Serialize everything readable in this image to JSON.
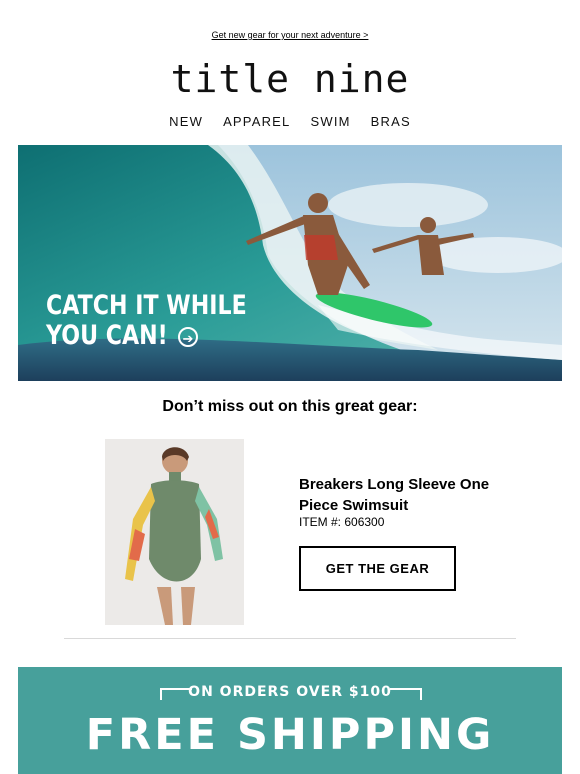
{
  "preheader": {
    "link_text": "Get new gear for your next adventure >"
  },
  "brand": {
    "logo_text": "title nine"
  },
  "nav": {
    "items": [
      "NEW",
      "APPAREL",
      "SWIM",
      "BRAS"
    ]
  },
  "hero": {
    "headline_line1": "CATCH IT WHILE",
    "headline_line2": "YOU CAN!",
    "arrow_icon": "circle-arrow-right-icon"
  },
  "intro": {
    "text": "Don’t miss out on this great gear:"
  },
  "product": {
    "name": "Breakers Long Sleeve One Piece Swimsuit",
    "item_number": "ITEM #: 606300",
    "cta_label": "GET THE GEAR"
  },
  "promo": {
    "top_text": "ON ORDERS OVER $100",
    "headline": "FREE SHIPPING"
  },
  "colors": {
    "promo_bg": "#47a09b",
    "wave": "#1f8f8f",
    "board": "#2fc66a"
  }
}
